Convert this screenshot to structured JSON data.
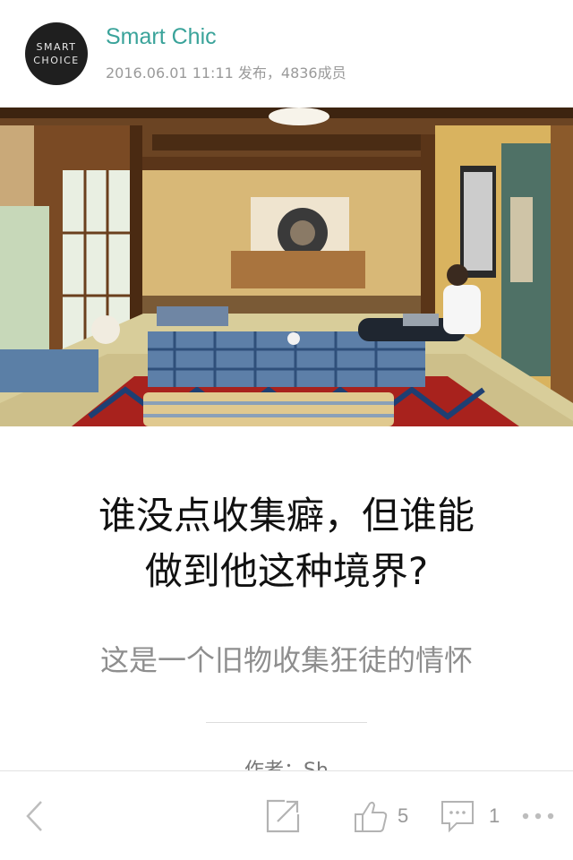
{
  "header": {
    "avatar_line1": "SMART",
    "avatar_line2": "CHOICE",
    "channel_name": "Smart Chic",
    "meta": "2016.06.01 11:11 发布，4836成员"
  },
  "article": {
    "title_line1": "谁没点收集癖，但谁能",
    "title_line2": "做到他这种境界?",
    "subtitle": "这是一个旧物收集狂徒的情怀",
    "author_peek": "作者：Sh"
  },
  "toolbar": {
    "like_count": "5",
    "comment_count": "1"
  },
  "icons": [
    "back-icon",
    "share-icon",
    "thumbs-up-icon",
    "comment-icon",
    "more-icon"
  ],
  "colors": {
    "accent": "#3aa39a",
    "meta_text": "#9a9a9a",
    "icon": "#b3b3b3"
  }
}
